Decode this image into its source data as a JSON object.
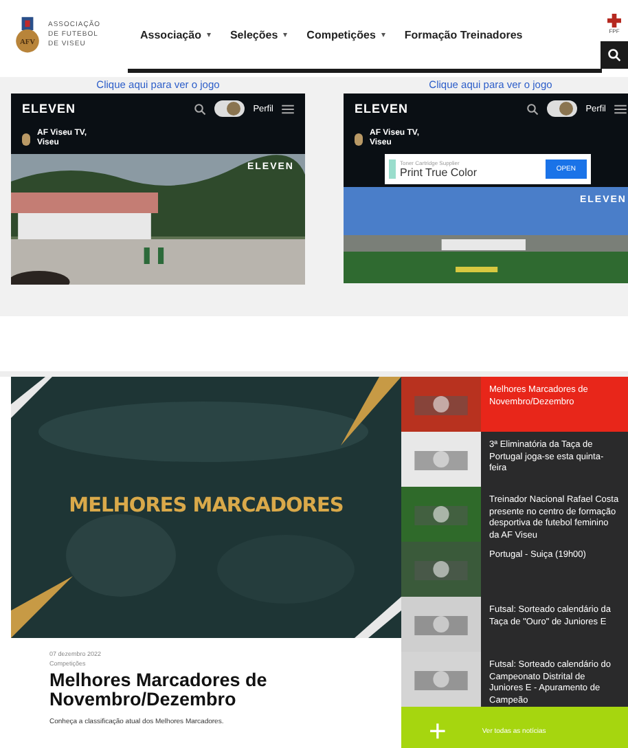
{
  "header": {
    "logo_text": "ASSOCIAÇÃO DE FUTEBOL DE VISEU",
    "logo_monogram": "AFV",
    "nav": [
      {
        "label": "Associação",
        "caret": "▾"
      },
      {
        "label": "Seleções",
        "caret": "▾"
      },
      {
        "label": "Competições",
        "caret": "▾"
      },
      {
        "label": "Formação Treinadores"
      }
    ],
    "fpf_label": "FPF"
  },
  "videos": [
    {
      "link": "Clique aqui para ver o jogo",
      "brand": "ELEVEN",
      "profile": "Perfil",
      "channel": "AF Viseu TV,",
      "city": "Viseu",
      "watermark": "ELEVEN"
    },
    {
      "link": "Clique aqui para ver o jogo",
      "brand": "ELEVEN",
      "profile": "Perfil",
      "channel": "AF Viseu TV,",
      "city": "Viseu",
      "watermark": "ELEVEN",
      "ad": {
        "supplier": "Toner Cartridge Supplier",
        "title": "Print True Color",
        "button": "OPEN"
      }
    }
  ],
  "feature": {
    "banner": "MELHORES MARCADORES",
    "date": "07 dezembro 2022",
    "category": "Competições",
    "title": "Melhores Marcadores de Novembro/Dezembro",
    "summary": "Conheça a classificação atual dos Melhores Marcadores."
  },
  "news": [
    {
      "title": "Melhores Marcadores de Novembro/Dezembro",
      "selected": true
    },
    {
      "title": "3ª Eliminatória da Taça de Portugal joga-se esta quinta-feira",
      "selected": false
    },
    {
      "title": "Treinador Nacional Rafael Costa presente no centro de formação desportiva de futebol feminino da AF Viseu",
      "selected": false
    },
    {
      "title": "Portugal - Suiça (19h00)",
      "selected": false
    },
    {
      "title": "Futsal: Sorteado calendário da Taça de \"Ouro\" de Juniores E",
      "selected": false
    },
    {
      "title": "Futsal: Sorteado calendário do Campeonato Distrital de Juniores E - Apuramento de Campeão",
      "selected": false
    }
  ],
  "all_news": {
    "icon": "+",
    "label": "Ver todas as notícias"
  }
}
